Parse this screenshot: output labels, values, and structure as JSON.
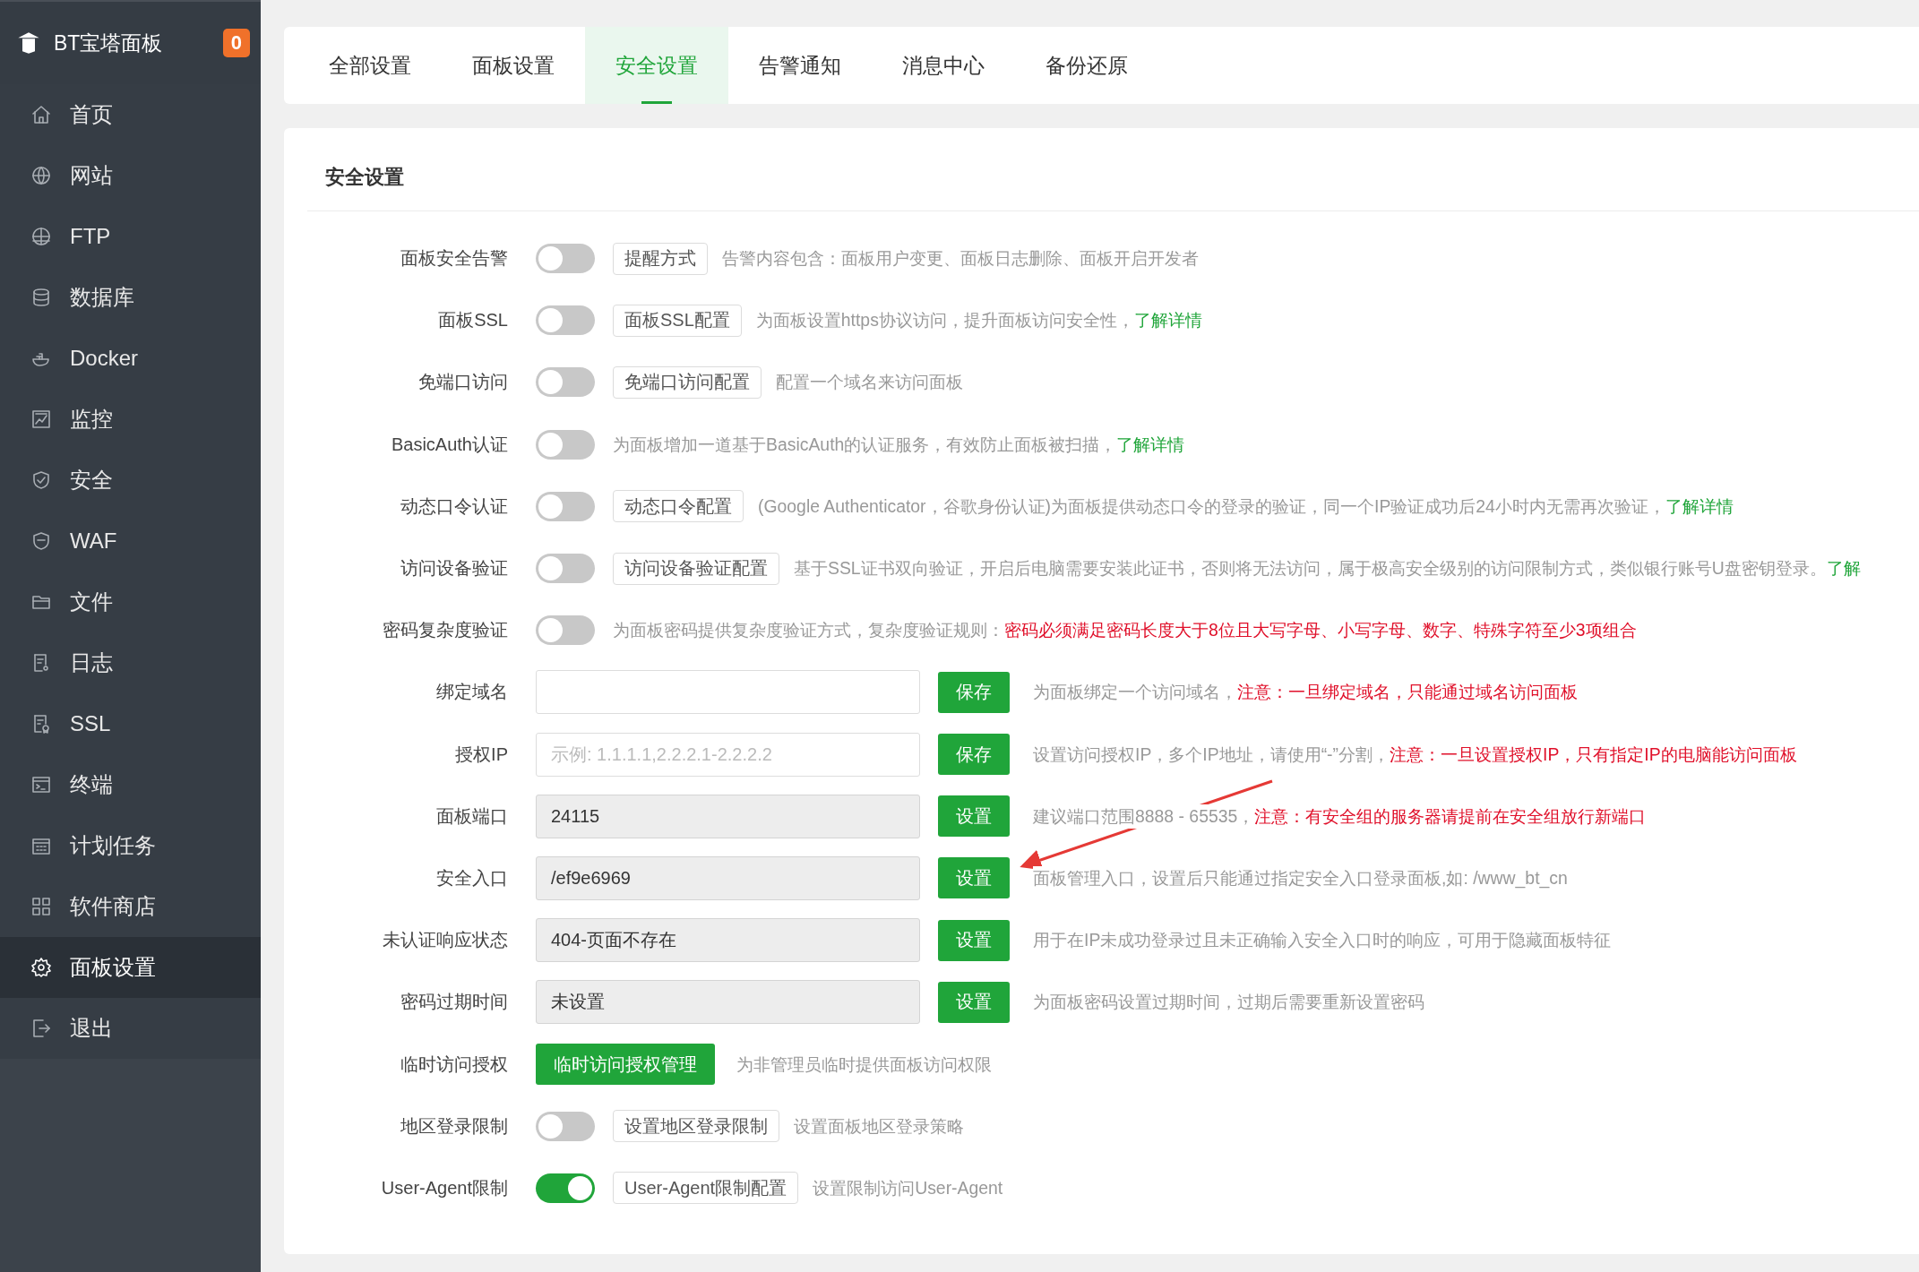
{
  "sidebar": {
    "logo_text": "BT宝塔面板",
    "badge": "0",
    "items": [
      {
        "label": "首页",
        "selected": false
      },
      {
        "label": "网站",
        "selected": false
      },
      {
        "label": "FTP",
        "selected": false
      },
      {
        "label": "数据库",
        "selected": false
      },
      {
        "label": "Docker",
        "selected": false
      },
      {
        "label": "监控",
        "selected": false
      },
      {
        "label": "安全",
        "selected": false
      },
      {
        "label": "WAF",
        "selected": false
      },
      {
        "label": "文件",
        "selected": false
      },
      {
        "label": "日志",
        "selected": false
      },
      {
        "label": "SSL",
        "selected": false
      },
      {
        "label": "终端",
        "selected": false
      },
      {
        "label": "计划任务",
        "selected": false
      },
      {
        "label": "软件商店",
        "selected": false
      },
      {
        "label": "面板设置",
        "selected": true
      },
      {
        "label": "退出",
        "selected": false
      }
    ]
  },
  "tabs": [
    {
      "label": "全部设置",
      "selected": false
    },
    {
      "label": "面板设置",
      "selected": false
    },
    {
      "label": "安全设置",
      "selected": true
    },
    {
      "label": "告警通知",
      "selected": false
    },
    {
      "label": "消息中心",
      "selected": false
    },
    {
      "label": "备份还原",
      "selected": false
    }
  ],
  "section_title": "安全设置",
  "rows": [
    {
      "kind": "toggle",
      "label": "面板安全告警",
      "on": false,
      "button": "提醒方式",
      "description": [
        {
          "kind": "note",
          "text": "告警内容包含：面板用户变更、面板日志删除、面板开启开发者"
        }
      ]
    },
    {
      "kind": "toggle",
      "label": "面板SSL",
      "on": false,
      "button": "面板SSL配置",
      "description": [
        {
          "kind": "note",
          "text": "为面板设置https协议访问，提升面板访问安全性，"
        },
        {
          "kind": "link",
          "text": "了解详情"
        }
      ]
    },
    {
      "kind": "toggle",
      "label": "免端口访问",
      "on": false,
      "button": "免端口访问配置",
      "description": [
        {
          "kind": "note",
          "text": "配置一个域名来访问面板"
        }
      ]
    },
    {
      "kind": "toggle",
      "label": "BasicAuth认证",
      "on": false,
      "description": [
        {
          "kind": "note",
          "text": "为面板增加一道基于BasicAuth的认证服务，有效防止面板被扫描，"
        },
        {
          "kind": "link",
          "text": "了解详情"
        }
      ]
    },
    {
      "kind": "toggle",
      "label": "动态口令认证",
      "on": false,
      "button": "动态口令配置",
      "description": [
        {
          "kind": "note",
          "text": "(Google Authenticator，谷歌身份认证)为面板提供动态口令的登录的验证，同一个IP验证成功后24小时内无需再次验证，"
        },
        {
          "kind": "link",
          "text": "了解详情"
        }
      ]
    },
    {
      "kind": "toggle",
      "label": "访问设备验证",
      "on": false,
      "button": "访问设备验证配置",
      "description": [
        {
          "kind": "note",
          "text": "基于SSL证书双向验证，开启后电脑需要安装此证书，否则将无法访问，属于极高安全级别的访问限制方式，类似银行账号U盘密钥登录。"
        },
        {
          "kind": "link",
          "text": "了解"
        }
      ]
    },
    {
      "kind": "toggle",
      "label": "密码复杂度验证",
      "on": false,
      "description": [
        {
          "kind": "note",
          "text": "为面板密码提供复杂度验证方式，复杂度验证规则："
        },
        {
          "kind": "warning",
          "text": "密码必须满足密码长度大于8位且大写字母、小写字母、数字、特殊字符至少3项组合"
        }
      ]
    },
    {
      "kind": "input",
      "label": "绑定域名",
      "disabled": false,
      "button": "保存",
      "description": [
        {
          "kind": "note",
          "text": "为面板绑定一个访问域名，"
        },
        {
          "kind": "warning",
          "text": "注意：一旦绑定域名，只能通过域名访问面板"
        }
      ]
    },
    {
      "kind": "input",
      "label": "授权IP",
      "disabled": false,
      "placeholder": "示例: 1.1.1.1,2.2.2.1-2.2.2.2",
      "button": "保存",
      "description": [
        {
          "kind": "note",
          "text": "设置访问授权IP，多个IP地址，请使用“-”分割，"
        },
        {
          "kind": "warning",
          "text": "注意：一旦设置授权IP，只有指定IP的电脑能访问面板"
        }
      ]
    },
    {
      "kind": "input",
      "label": "面板端口",
      "disabled": true,
      "value": "24115",
      "button": "设置",
      "description": [
        {
          "kind": "note",
          "text": "建议端口范围8888 - 65535，"
        },
        {
          "kind": "warning",
          "text": "注意：有安全组的服务器请提前在安全组放行新端口"
        }
      ]
    },
    {
      "kind": "input",
      "label": "安全入口",
      "disabled": true,
      "value": "/ef9e6969",
      "button": "设置",
      "description": [
        {
          "kind": "note",
          "text": "面板管理入口，设置后只能通过指定安全入口登录面板,如: /www_bt_cn"
        }
      ]
    },
    {
      "kind": "input",
      "label": "未认证响应状态",
      "disabled": true,
      "value": "404-页面不存在",
      "button": "设置",
      "description": [
        {
          "kind": "note",
          "text": "用于在IP未成功登录过且未正确输入安全入口时的响应，可用于隐藏面板特征"
        }
      ]
    },
    {
      "kind": "input",
      "label": "密码过期时间",
      "disabled": true,
      "value": "未设置",
      "button": "设置",
      "description": [
        {
          "kind": "note",
          "text": "为面板密码设置过期时间，过期后需要重新设置密码"
        }
      ]
    },
    {
      "kind": "action",
      "label": "临时访问授权",
      "button": "临时访问授权管理",
      "description": [
        {
          "kind": "note",
          "text": "为非管理员临时提供面板访问权限"
        }
      ]
    },
    {
      "kind": "toggle",
      "label": "地区登录限制",
      "on": false,
      "button": "设置地区登录限制",
      "description": [
        {
          "kind": "note",
          "text": "设置面板地区登录策略"
        }
      ]
    },
    {
      "kind": "toggle",
      "label": "User-Agent限制",
      "on": true,
      "button": "User-Agent限制配置",
      "description": [
        {
          "kind": "note",
          "text": "设置限制访问User-Agent"
        }
      ]
    }
  ]
}
